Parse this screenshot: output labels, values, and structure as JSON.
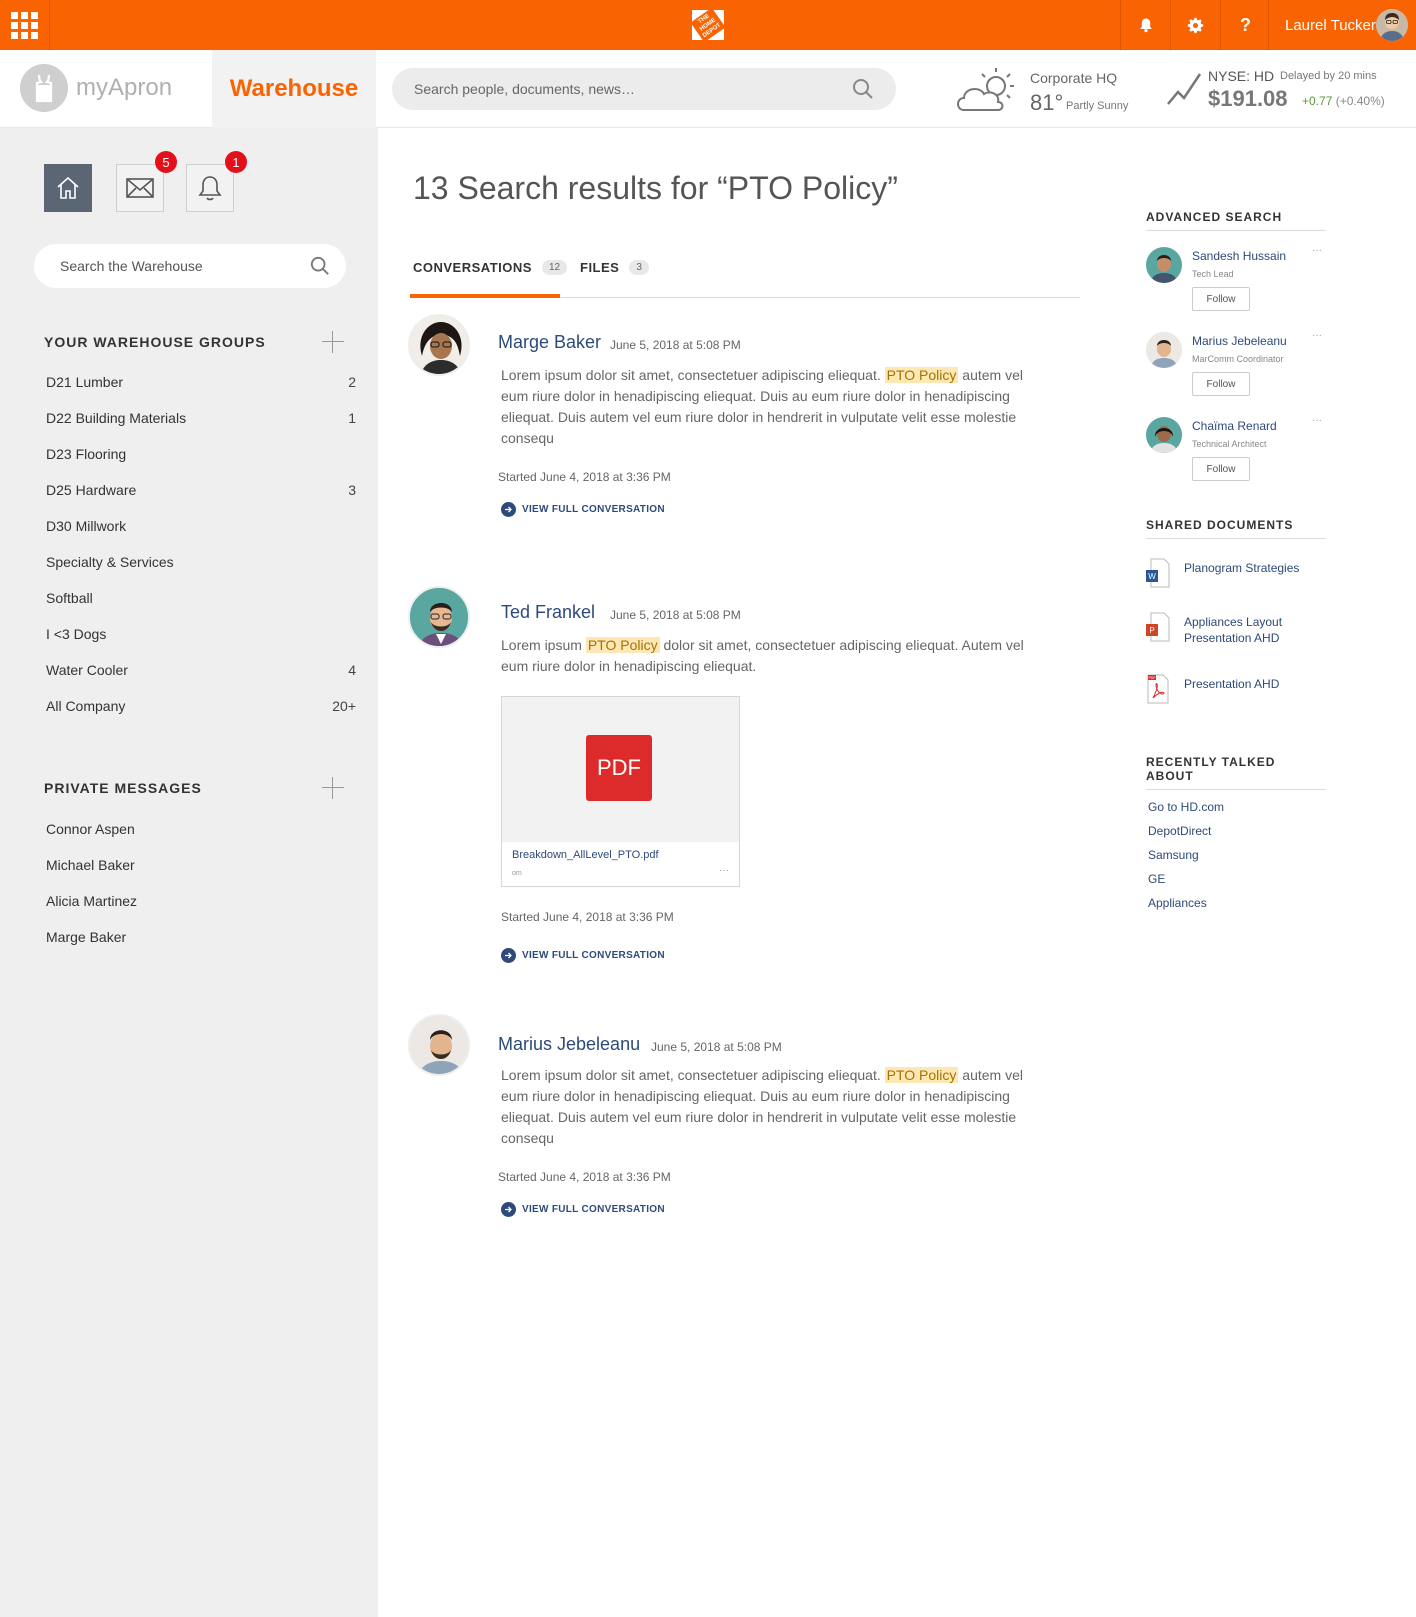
{
  "topbar": {
    "logo_text": "THE HOME DEPOT",
    "user_name": "Laurel Tucker",
    "brand_color": "#f96302",
    "icons": [
      "apps-icon",
      "bell-icon",
      "gear-icon",
      "help-icon"
    ]
  },
  "header": {
    "brand_name": "myApron",
    "section_tab": "Warehouse",
    "search_placeholder": "Search people, documents, news…",
    "weather": {
      "location": "Corporate HQ",
      "temp": "81°",
      "condition": "Partly Sunny"
    },
    "stock": {
      "symbol": "NYSE: HD",
      "delay": "Delayed by 20 mins",
      "price": "$191.08",
      "change": "+0.77",
      "change_pct": "(+0.40%)"
    }
  },
  "sidebar": {
    "quick_buttons": [
      {
        "name": "home",
        "badge": ""
      },
      {
        "name": "mail",
        "badge": "5"
      },
      {
        "name": "notifications",
        "badge": "1"
      }
    ],
    "search_placeholder": "Search the Warehouse",
    "groups_heading": "YOUR WAREHOUSE GROUPS",
    "groups": [
      {
        "label": "D21 Lumber",
        "count": "2"
      },
      {
        "label": "D22 Building Materials",
        "count": "1"
      },
      {
        "label": "D23 Flooring",
        "count": ""
      },
      {
        "label": "D25 Hardware",
        "count": "3"
      },
      {
        "label": "D30 Millwork",
        "count": ""
      },
      {
        "label": "Specialty & Services",
        "count": ""
      },
      {
        "label": "Softball",
        "count": ""
      },
      {
        "label": "I <3 Dogs",
        "count": ""
      },
      {
        "label": "Water Cooler",
        "count": "4"
      },
      {
        "label": "All Company",
        "count": "20+"
      }
    ],
    "messages_heading": "PRIVATE MESSAGES",
    "messages": [
      {
        "label": "Connor Aspen"
      },
      {
        "label": "Michael Baker"
      },
      {
        "label": "Alicia Martinez"
      },
      {
        "label": "Marge Baker"
      }
    ]
  },
  "main": {
    "title": "13 Search results for “PTO Policy”",
    "tabs": [
      {
        "label": "CONVERSATIONS",
        "count": "12"
      },
      {
        "label": "FILES",
        "count": "3"
      }
    ],
    "highlight": "PTO Policy",
    "posts": [
      {
        "author": "Marge Baker",
        "date": "June 5, 2018 at 5:08 PM",
        "body_before": "Lorem ipsum dolor sit amet, consectetuer adipiscing eliequat.",
        "body_after": "autem vel eum riure dolor in henadipiscing eliequat. Duis au eum riure dolor in henadipiscing eliequat. Duis autem vel eum riure dolor in hendrerit in vulputate velit esse molestie consequ",
        "started": "Started June 4, 2018 at 3:36 PM",
        "view_label": "VIEW FULL CONVERSATION"
      },
      {
        "author": "Ted Frankel",
        "date": "June 5, 2018 at 5:08 PM",
        "body_before": "Lorem ipsum",
        "body_after": "dolor sit amet, consectetuer adipiscing eliequat. Autem vel eum riure dolor in henadipiscing eliequat.",
        "attachment": {
          "type_label": "PDF",
          "name": "Breakdown_AllLevel_PTO.pdf",
          "meta": "om",
          "more": "···"
        },
        "started": "Started June 4, 2018 at 3:36 PM",
        "view_label": "VIEW FULL CONVERSATION"
      },
      {
        "author": "Marius Jebeleanu",
        "date": "June 5, 2018 at 5:08 PM",
        "body_before": "Lorem ipsum dolor sit amet, consectetuer adipiscing eliequat.",
        "body_after": "autem vel eum riure dolor in henadipiscing eliequat. Duis au eum riure dolor in henadipiscing eliequat. Duis autem vel eum riure dolor in hendrerit in vulputate velit esse molestie consequ",
        "started": "Started June 4, 2018 at 3:36 PM",
        "view_label": "VIEW FULL CONVERSATION"
      }
    ]
  },
  "right": {
    "advanced_heading": "ADVANCED SEARCH",
    "people": [
      {
        "name": "Sandesh Hussain",
        "role": "Tech Lead",
        "follow": "Follow",
        "more": "···"
      },
      {
        "name": "Marius Jebeleanu",
        "role": "MarComm Coordinator",
        "follow": "Follow",
        "more": "···"
      },
      {
        "name": "Chaïma Renard",
        "role": "Technical Architect",
        "follow": "Follow",
        "more": "···"
      }
    ],
    "docs_heading": "SHARED DOCUMENTS",
    "documents": [
      {
        "name": "Planogram Strategies",
        "type": "word-doc-icon",
        "type_letter": "W"
      },
      {
        "name": "Appliances Layout Presentation AHD",
        "type": "powerpoint-doc-icon",
        "type_letter": "P"
      },
      {
        "name": "Presentation AHD",
        "type": "pdf-doc-icon",
        "type_letter": "PDF"
      }
    ],
    "topics_heading": "RECENTLY TALKED ABOUT",
    "topics": [
      "Go to HD.com",
      "DepotDirect",
      "Samsung",
      "GE",
      "Appliances"
    ]
  }
}
